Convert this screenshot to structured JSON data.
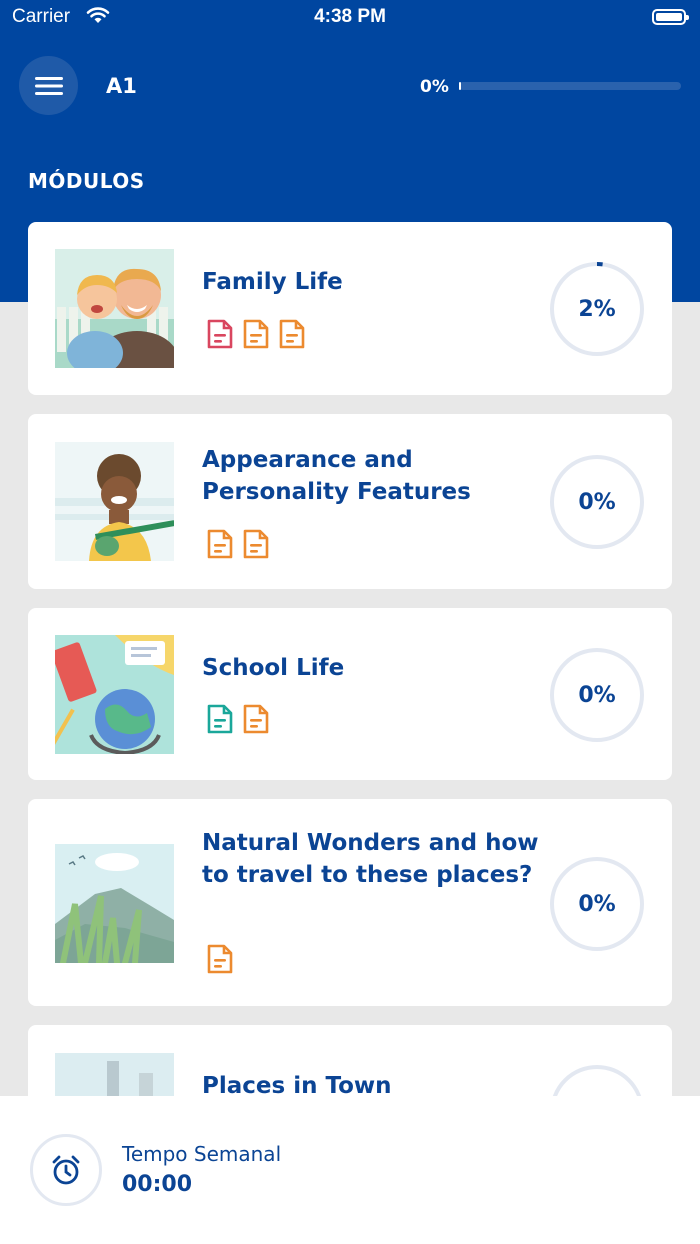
{
  "status_bar": {
    "carrier": "Carrier",
    "time": "4:38 PM"
  },
  "header": {
    "level": "A1",
    "progress_label": "0%",
    "progress_fraction": 0.0
  },
  "section_title": "MÓDULOS",
  "colors": {
    "brand_blue": "#0046a0",
    "text_blue": "#0b4494",
    "doc_red": "#d9465f",
    "doc_orange": "#ec8a2f",
    "doc_teal": "#1aa79a"
  },
  "modules": [
    {
      "title": "Family Life",
      "progress_label": "2%",
      "progress": 0.02,
      "icons": [
        "document-red-icon",
        "document-orange-icon",
        "document-orange-icon"
      ]
    },
    {
      "title": "Appearance and Personality Features",
      "progress_label": "0%",
      "progress": 0.0,
      "icons": [
        "document-orange-icon",
        "document-orange-icon"
      ]
    },
    {
      "title": "School Life",
      "progress_label": "0%",
      "progress": 0.0,
      "icons": [
        "document-teal-icon",
        "document-orange-icon"
      ]
    },
    {
      "title": "Natural Wonders and how to travel to these places?",
      "progress_label": "0%",
      "progress": 0.0,
      "icons": [
        "document-orange-icon"
      ]
    },
    {
      "title": "Places in Town",
      "progress_label": "",
      "progress": 0.0,
      "icons": []
    }
  ],
  "weekly_timer": {
    "label": "Tempo Semanal",
    "value": "00:00",
    "icon": "alarm-clock-icon"
  }
}
